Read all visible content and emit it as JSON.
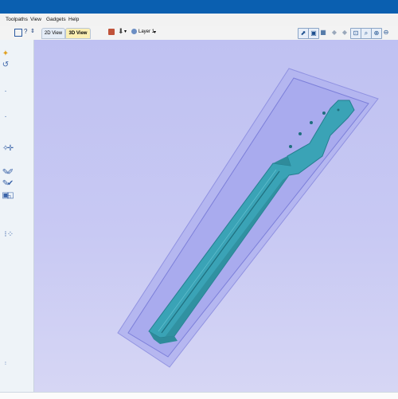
{
  "menu": {
    "items": [
      "Toolpaths",
      "View",
      "Gadgets",
      "Help"
    ]
  },
  "toolbar": {
    "left_marks": "?",
    "tabs": [
      {
        "label": "2D View",
        "active": false
      },
      {
        "label": "3D View",
        "active": true
      }
    ],
    "layer_label": "Layer 1"
  },
  "colors": {
    "titlebar": "#0a5fb0",
    "viewport_bg": "#c5c6f2",
    "neck_fill": "#3aa3b6",
    "tray": "#9d9fe6",
    "active_tab": "#fbefb3"
  },
  "icons": {
    "toolbar_right": [
      "view-3d-icon",
      "view-top-icon",
      "grid-icon",
      "arrow-left-icon",
      "arrow-right-icon",
      "zoom-fit-icon",
      "zoom-icon",
      "zoom-in-icon",
      "zoom-out-icon",
      "rotate-icon"
    ],
    "left_panel": [
      "lamp-icon",
      "rotate-icon",
      "node-icon",
      "wand-icon",
      "pencil-icon",
      "toolpath-icon",
      "offset-icon",
      "array-icon"
    ]
  }
}
